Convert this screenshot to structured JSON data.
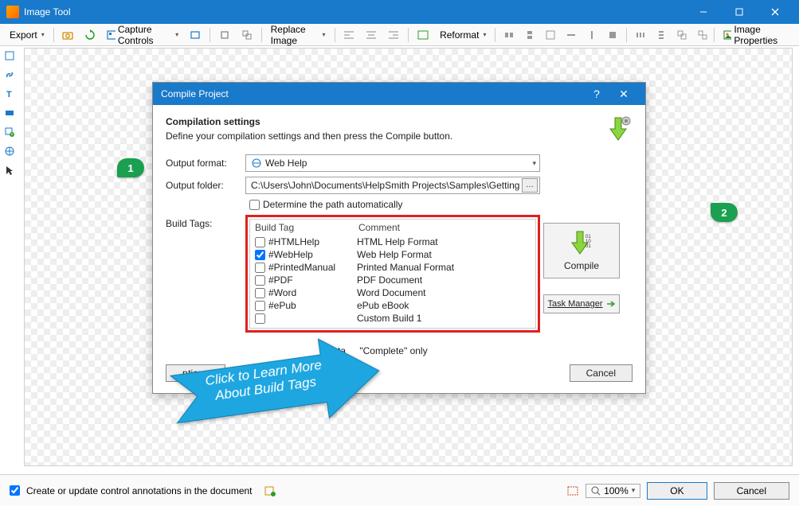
{
  "window": {
    "title": "Image Tool"
  },
  "toolbar": {
    "export": "Export",
    "capture_controls": "Capture Controls",
    "replace_image": "Replace Image",
    "reformat": "Reformat",
    "image_properties": "Image Properties"
  },
  "dialog": {
    "title": "Compile Project",
    "header_title": "Compilation settings",
    "header_sub": "Define your compilation settings and then press the Compile button.",
    "output_format_label": "Output format:",
    "output_format_value": "Web Help",
    "output_folder_label": "Output folder:",
    "output_folder_value": "C:\\Users\\John\\Documents\\HelpSmith Projects\\Samples\\Getting Started\\Gett",
    "auto_path_label": "Determine the path automatically",
    "build_tags_label": "Build Tags:",
    "col_tag": "Build Tag",
    "col_comment": "Comment",
    "tags": [
      {
        "name": "#HTMLHelp",
        "comment": "HTML Help Format",
        "checked": false
      },
      {
        "name": "#WebHelp",
        "comment": "Web Help Format",
        "checked": true
      },
      {
        "name": "#PrintedManual",
        "comment": "Printed Manual Format",
        "checked": false
      },
      {
        "name": "#PDF",
        "comment": "PDF Document",
        "checked": false
      },
      {
        "name": "#Word",
        "comment": "Word Document",
        "checked": false
      },
      {
        "name": "#ePub",
        "comment": "ePub eBook",
        "checked": false
      },
      {
        "name": "",
        "comment": "Custom Build 1",
        "checked": false
      }
    ],
    "complete_only": "\"Complete\" only",
    "complete_prefix": "sta",
    "options_btn": "Options...",
    "cancel_btn": "Cancel",
    "compile_btn": "Compile",
    "task_manager": "Task Manager"
  },
  "callout": {
    "line1": "Click to Learn More",
    "line2": "About Build Tags"
  },
  "badges": {
    "b1": "1",
    "b2": "2"
  },
  "footer": {
    "checkbox_label": "Create or update control annotations in the document",
    "zoom": "100%",
    "ok": "OK",
    "cancel": "Cancel"
  }
}
